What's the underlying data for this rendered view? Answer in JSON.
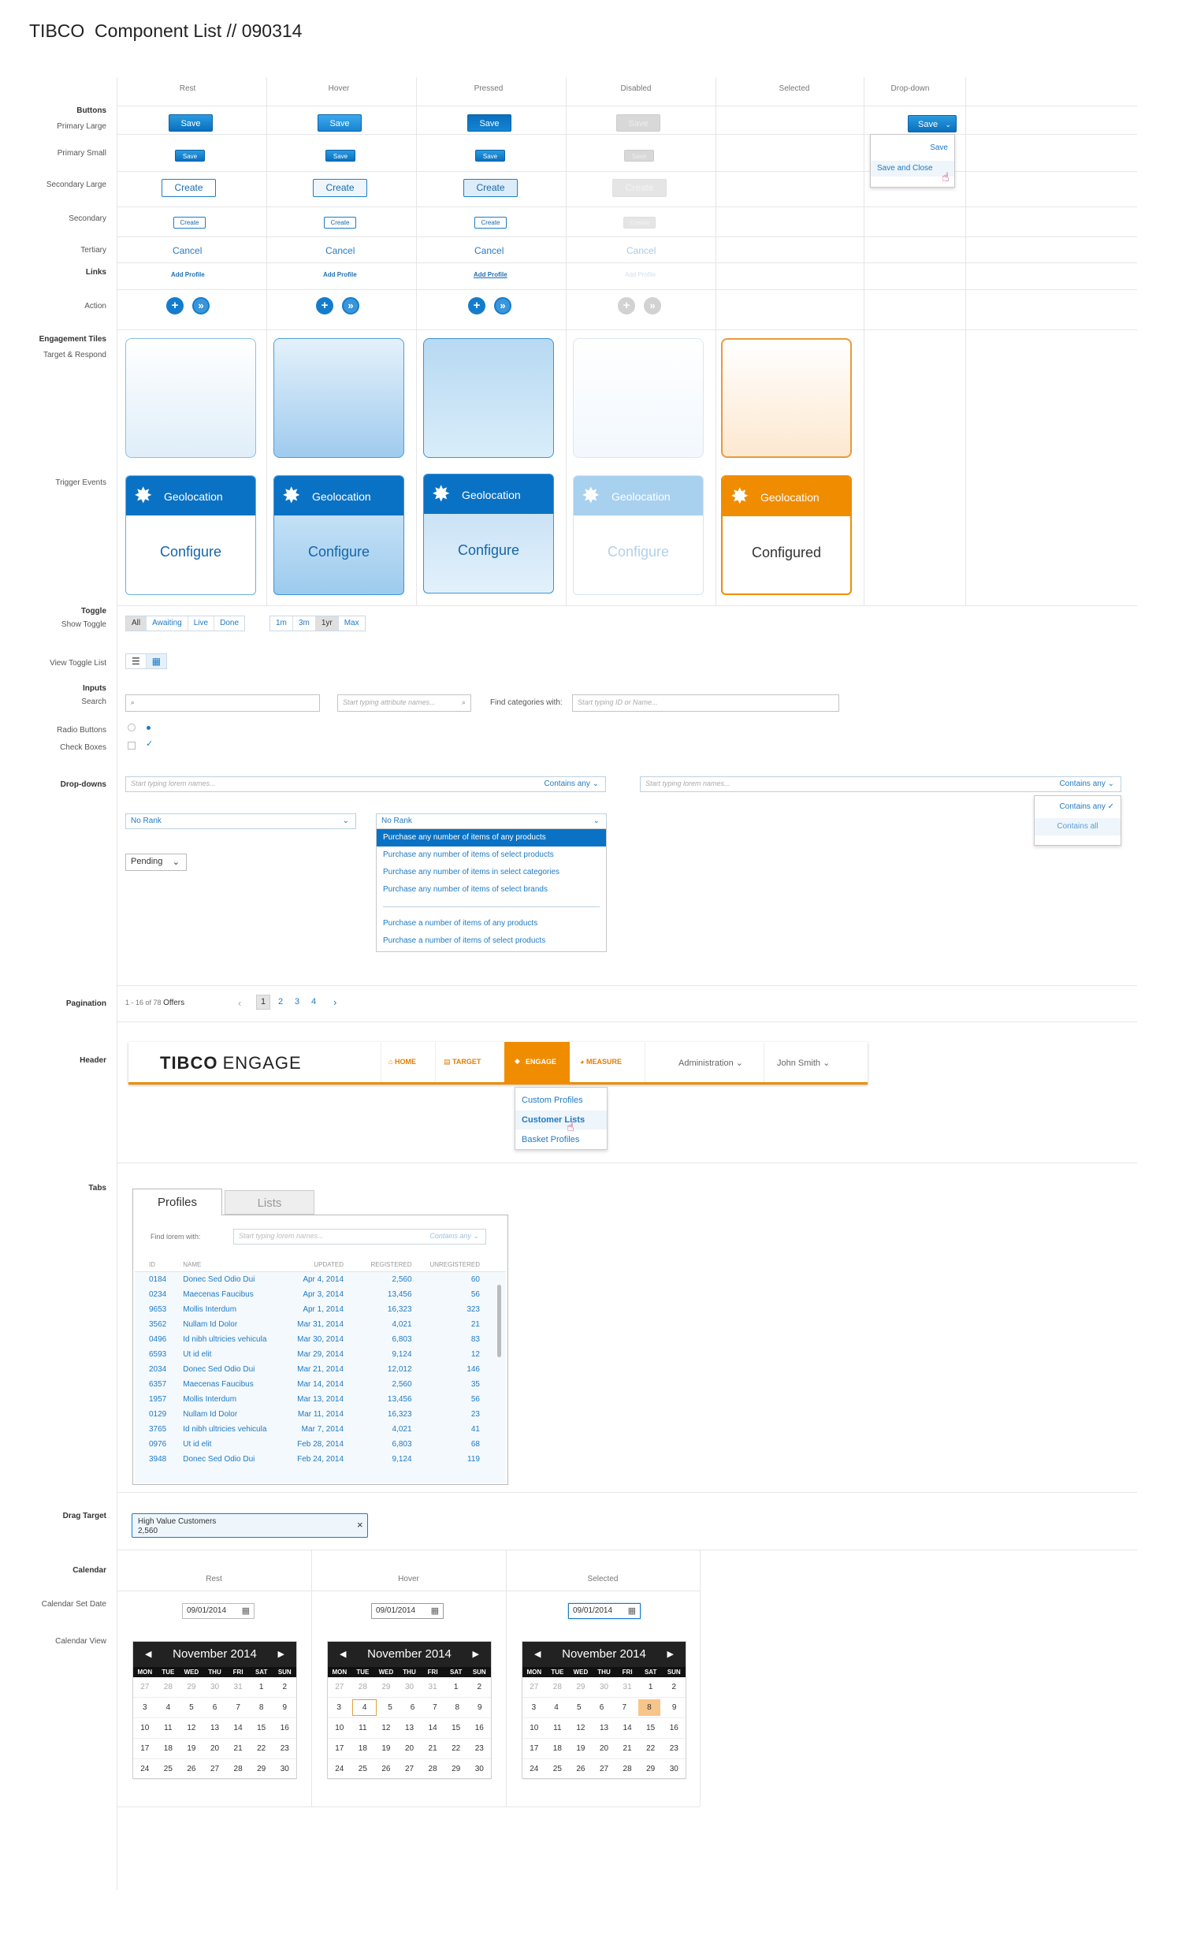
{
  "title": "TIBCO  Component List // 090314",
  "columns": [
    "Rest",
    "Hover",
    "Pressed",
    "Disabled",
    "Selected",
    "Drop-down"
  ],
  "labels": {
    "buttons": "Buttons",
    "primary_large": "Primary Large",
    "primary_small": "Primary Small",
    "secondary_large": "Secondary Large",
    "secondary": "Secondary",
    "tertiary": "Tertiary",
    "links": "Links",
    "action": "Action",
    "engagement_tiles": "Engagement Tiles",
    "target_respond": "Target & Respond",
    "trigger_events": "Trigger Events",
    "toggle": "Toggle",
    "show_toggle": "Show Toggle",
    "view_toggle_list": "View Toggle List",
    "inputs": "Inputs",
    "search": "Search",
    "radio_buttons": "Radio Buttons",
    "check_boxes": "Check Boxes",
    "dropdowns": "Drop-downs",
    "pagination": "Pagination",
    "header": "Header",
    "tabs": "Tabs",
    "drag_target": "Drag Target",
    "calendar": "Calendar",
    "calendar_set_date": "Calendar Set Date",
    "calendar_view": "Calendar View"
  },
  "buttons": {
    "save": "Save",
    "create": "Create",
    "cancel": "Cancel",
    "add_profile": "Add Profile",
    "plus": "+",
    "forward": "»",
    "dropdown_save": "Save",
    "dropdown_menu": [
      "Save",
      "Save and Close"
    ]
  },
  "trigger": {
    "name": "Geolocation",
    "configure": "Configure",
    "configured": "Configured"
  },
  "toggle": {
    "show": [
      "All",
      "Awaiting",
      "Live",
      "Done"
    ],
    "range": [
      "1m",
      "3m",
      "1yr",
      "Max"
    ]
  },
  "inputs": {
    "attr_placeholder": "Start typing attribute names...",
    "find_categories_label": "Find categories with:",
    "find_placeholder": "Start typing ID or Name..."
  },
  "dropdowns": {
    "lorem_placeholder": "Start typing lorem names...",
    "contains_any": "Contains any",
    "contains_menu": [
      "Contains any",
      "Contains all"
    ],
    "no_rank": "No Rank",
    "rank_menu": [
      "Purchase any number of items of any products",
      "Purchase any number of items of select products",
      "Purchase any number of items in select categories",
      "Purchase any number of items of select brands",
      "Purchase a number of items of any products",
      "Purchase a number of items of select products"
    ],
    "pending": "Pending"
  },
  "pagination": {
    "range": "1 - 16 of 78",
    "unit": "Offers",
    "pages": [
      "1",
      "2",
      "3",
      "4"
    ],
    "prev": "‹",
    "next": "›"
  },
  "header": {
    "brand": "TIBCO",
    "product": "ENGAGE",
    "nav": [
      "HOME",
      "TARGET",
      "ENGAGE",
      "MEASURE"
    ],
    "admin": "Administration",
    "user": "John Smith",
    "engage_menu": [
      "Custom Profiles",
      "Customer Lists",
      "Basket Profiles"
    ]
  },
  "tabs": {
    "tabs": [
      "Profiles",
      "Lists"
    ],
    "find_label": "Find lorem with:",
    "find_placeholder": "Start typing lorem names...",
    "contains_any": "Contains any",
    "columns": [
      "ID",
      "NAME",
      "UPDATED",
      "REGISTERED",
      "UNREGISTERED"
    ],
    "rows": [
      [
        "0184",
        "Donec Sed Odio Dui",
        "Apr 4, 2014",
        "2,560",
        "60"
      ],
      [
        "0234",
        "Maecenas Faucibus",
        "Apr 3, 2014",
        "13,456",
        "56"
      ],
      [
        "9653",
        "Mollis Interdum",
        "Apr 1, 2014",
        "16,323",
        "323"
      ],
      [
        "3562",
        "Nullam Id Dolor",
        "Mar 31, 2014",
        "4,021",
        "21"
      ],
      [
        "0496",
        "Id nibh ultricies vehicula",
        "Mar 30, 2014",
        "6,803",
        "83"
      ],
      [
        "6593",
        "Ut id elit",
        "Mar 29, 2014",
        "9,124",
        "12"
      ],
      [
        "2034",
        "Donec Sed Odio Dui",
        "Mar 21, 2014",
        "12,012",
        "146"
      ],
      [
        "6357",
        "Maecenas Faucibus",
        "Mar 14, 2014",
        "2,560",
        "35"
      ],
      [
        "1957",
        "Mollis Interdum",
        "Mar 13, 2014",
        "13,456",
        "56"
      ],
      [
        "0129",
        "Nullam Id Dolor",
        "Mar 11, 2014",
        "16,323",
        "23"
      ],
      [
        "3765",
        "Id nibh ultricies vehicula",
        "Mar 7, 2014",
        "4,021",
        "41"
      ],
      [
        "0976",
        "Ut id elit",
        "Feb 28, 2014",
        "6,803",
        "68"
      ],
      [
        "3948",
        "Donec Sed Odio Dui",
        "Feb 24, 2014",
        "9,124",
        "119"
      ]
    ]
  },
  "drag_target": {
    "name": "High Value Customers",
    "count": "2,560",
    "close": "×"
  },
  "calendar": {
    "columns": [
      "Rest",
      "Hover",
      "Selected"
    ],
    "date": "09/01/2014",
    "month": "November 2014",
    "dow": [
      "MON",
      "TUE",
      "WED",
      "THU",
      "FRI",
      "SAT",
      "SUN"
    ],
    "weeks": [
      [
        "27",
        "28",
        "29",
        "30",
        "31",
        "1",
        "2"
      ],
      [
        "3",
        "4",
        "5",
        "6",
        "7",
        "8",
        "9"
      ],
      [
        "10",
        "11",
        "12",
        "13",
        "14",
        "15",
        "16"
      ],
      [
        "17",
        "18",
        "19",
        "20",
        "21",
        "22",
        "23"
      ],
      [
        "24",
        "25",
        "26",
        "27",
        "28",
        "29",
        "30"
      ]
    ]
  },
  "colors": {
    "primary": "#0a72c4",
    "orange": "#f08c00",
    "dark": "#222222"
  }
}
